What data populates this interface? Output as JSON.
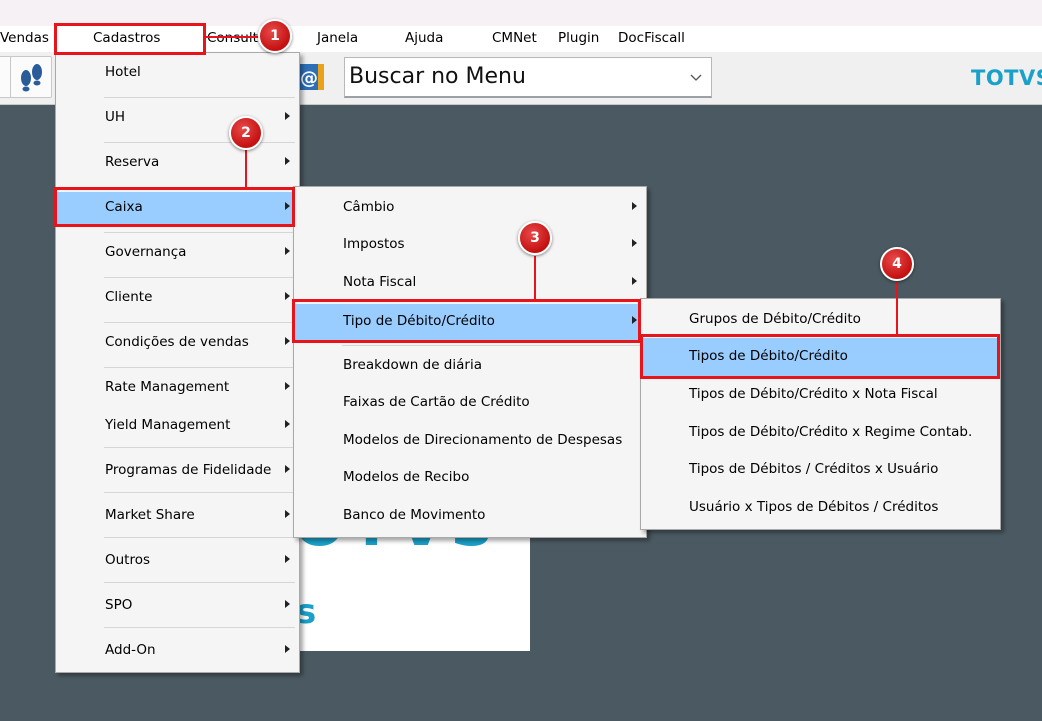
{
  "menubar": {
    "items": [
      "Vendas",
      "Cadastros",
      "Consultas",
      "Janela",
      "Ajuda",
      "CMNet",
      "Plugin",
      "DocFiscall"
    ]
  },
  "toolbar": {
    "search_value": "Buscar no Menu",
    "brand": "TOTVS"
  },
  "splash": {
    "logo_text": "OTVS",
    "sub_text": "s"
  },
  "cadastros_menu": {
    "items": [
      "Hotel",
      "UH",
      "Reserva",
      "Caixa",
      "Governança",
      "Cliente",
      "Condições de vendas",
      "Rate Management",
      "Yield Management",
      "Programas de Fidelidade",
      "Market Share",
      "Outros",
      "SPO",
      "Add-On"
    ]
  },
  "caixa_menu": {
    "items": [
      "Câmbio",
      "Impostos",
      "Nota Fiscal",
      "Tipo de Débito/Crédito",
      "Breakdown de diária",
      "Faixas de Cartão de Crédito",
      "Modelos de Direcionamento de Despesas",
      "Modelos de Recibo",
      "Banco de Movimento"
    ]
  },
  "tipo_menu": {
    "items": [
      "Grupos de Débito/Crédito",
      "Tipos de Débito/Crédito",
      "Tipos de Débito/Crédito x Nota Fiscal",
      "Tipos de Débito/Crédito x Regime Contab.",
      "Tipos de Débitos / Créditos x Usuário",
      "Usuário x Tipos de Débitos / Créditos"
    ]
  },
  "callouts": [
    "1",
    "2",
    "3",
    "4"
  ],
  "colors": {
    "highlight": "#99ccff",
    "callout": "#e8141c",
    "brand": "#1ba1c9",
    "background": "#4b5a62"
  }
}
